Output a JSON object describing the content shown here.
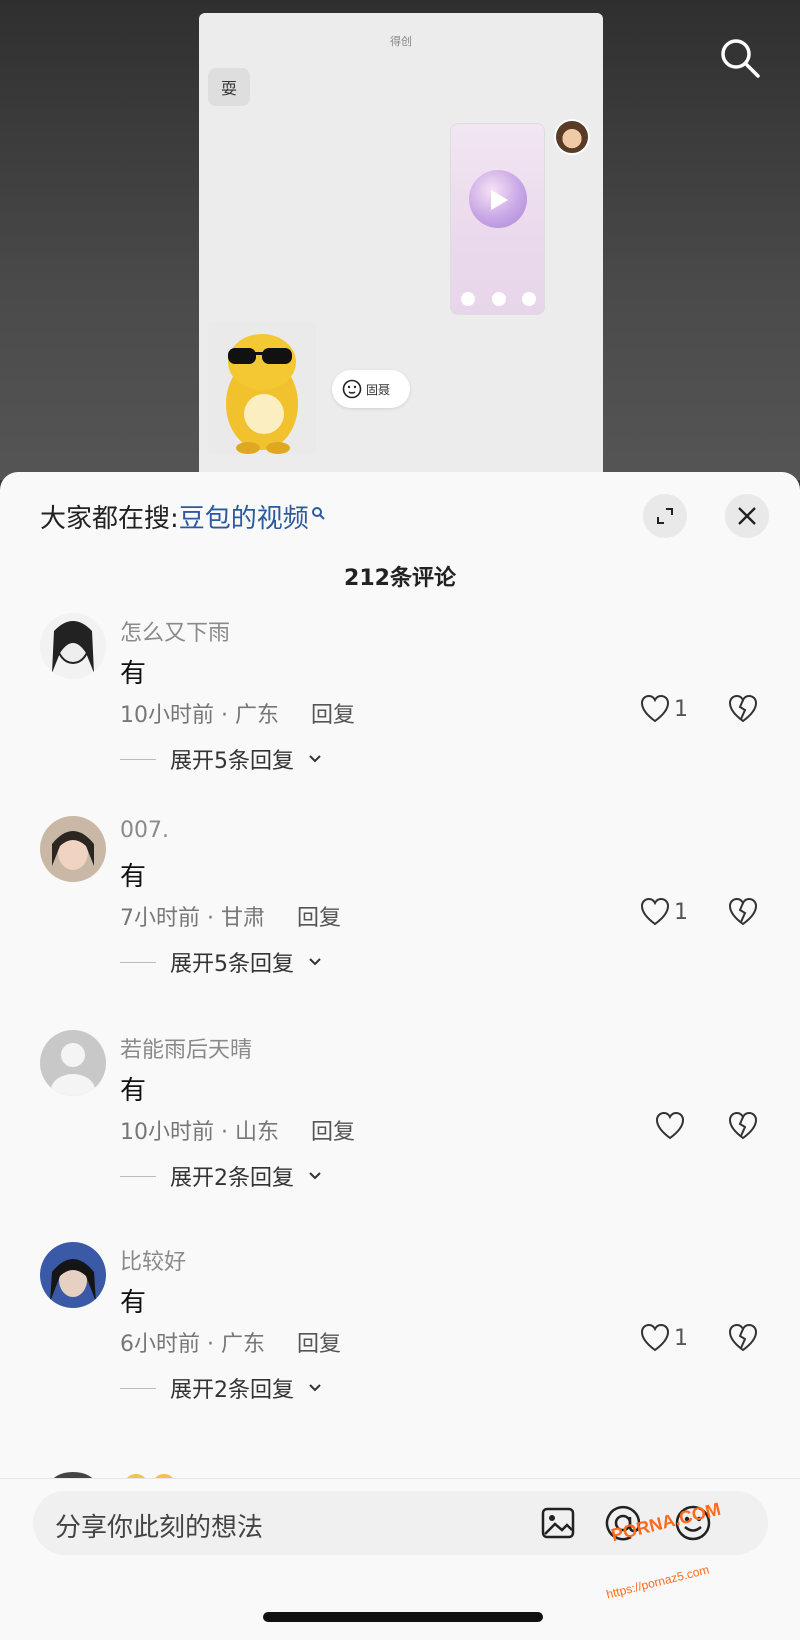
{
  "video": {
    "phone_title": "得创",
    "chip_label": "耍",
    "pose_button_label": "固聂"
  },
  "sheet": {
    "hot_search_prefix": "大家都在搜:",
    "hot_search_keyword": "豆包的视频",
    "comment_count": "212条评论"
  },
  "comments": [
    {
      "username": "怎么又下雨",
      "text": "有",
      "time_location": "10小时前 · 广东",
      "reply": "回复",
      "likes": "1",
      "expand": "展开5条回复"
    },
    {
      "username": "007.",
      "text": "有",
      "time_location": "7小时前 · 甘肃",
      "reply": "回复",
      "likes": "1",
      "expand": "展开5条回复"
    },
    {
      "username": "若能雨后天晴",
      "text": "有",
      "time_location": "10小时前 · 山东",
      "reply": "回复",
      "likes": "",
      "expand": "展开2条回复"
    },
    {
      "username": "比较好",
      "text": "有",
      "time_location": "6小时前 · 广东",
      "reply": "回复",
      "likes": "1",
      "expand": "展开2条回复"
    }
  ],
  "input": {
    "placeholder": "分享你此刻的想法"
  },
  "watermark": {
    "brand": "PORNA.COM",
    "url": "https://pornaz5.com"
  },
  "colors": {
    "keyword": "#2b5a9e",
    "sheet_bg": "#f9f9f9"
  }
}
